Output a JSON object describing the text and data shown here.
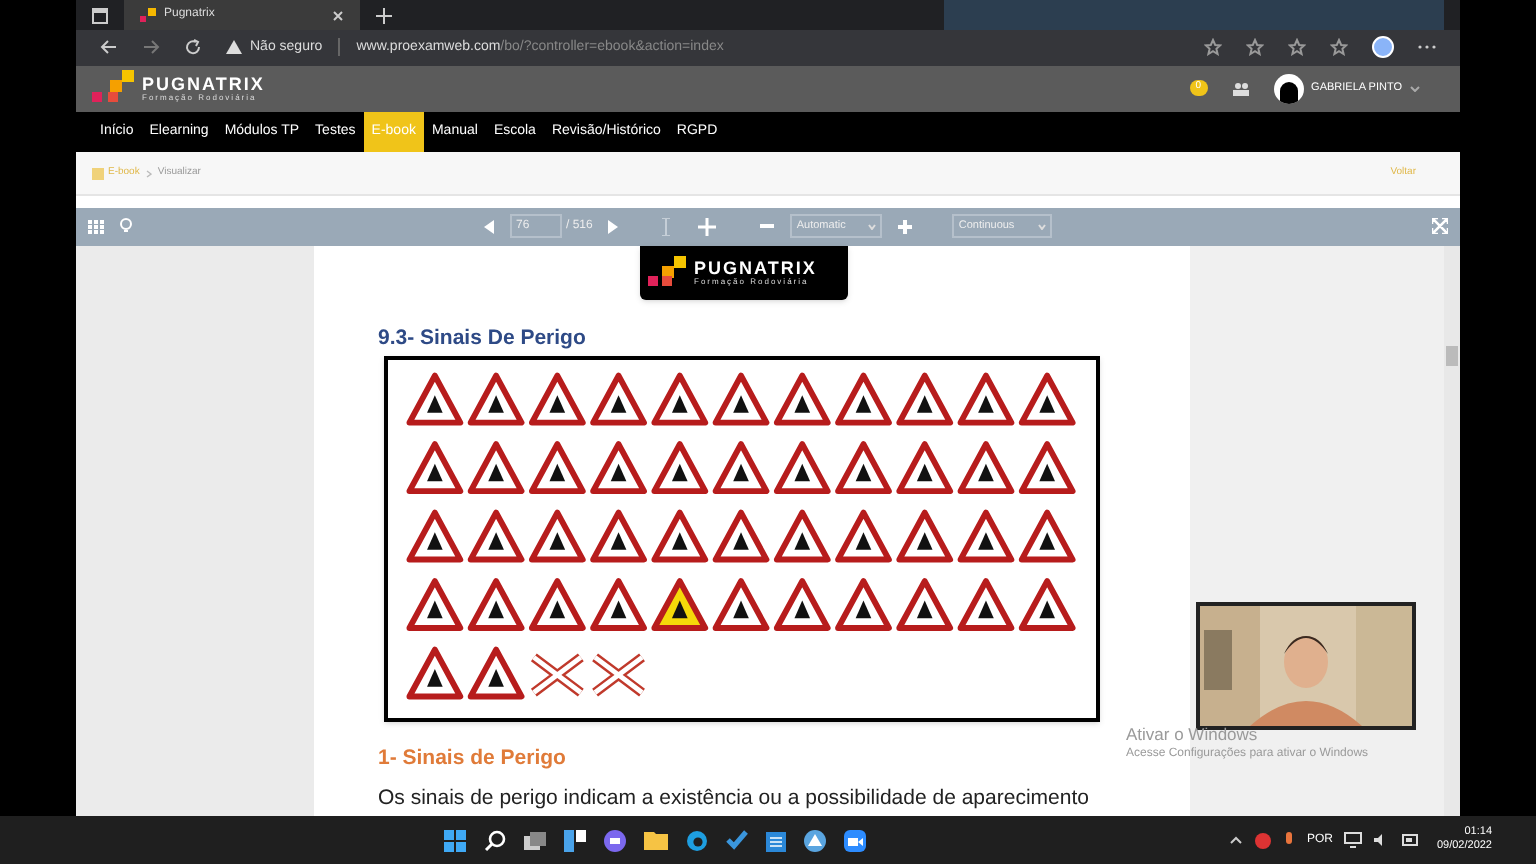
{
  "browser": {
    "tab_title": "Pugnatrix",
    "security": "Não seguro",
    "url_host": "www.proexamweb.com",
    "url_path": "/bo/?controller=ebook&action=index"
  },
  "site": {
    "logo_name": "PUGNATRIX",
    "logo_tagline": "Formação Rodoviária",
    "notification_count": "0",
    "user_name": "GABRIELA PINTO"
  },
  "nav": [
    {
      "label": "Início",
      "selected": false
    },
    {
      "label": "Elearning",
      "selected": false
    },
    {
      "label": "Módulos TP",
      "selected": false
    },
    {
      "label": "Testes",
      "selected": false
    },
    {
      "label": "E-book",
      "selected": true
    },
    {
      "label": "Manual",
      "selected": false
    },
    {
      "label": "Escola",
      "selected": false
    },
    {
      "label": "Revisão/Histórico",
      "selected": false
    },
    {
      "label": "RGPD",
      "selected": false
    }
  ],
  "breadcrumb": [
    "E-book",
    "Visualizar"
  ],
  "back_link": "Voltar",
  "pdf_toolbar": {
    "page": "76",
    "page_total": "/ 516",
    "zoom": "Automatic",
    "scroll_mode": "Continuous"
  },
  "document": {
    "logo_name": "PUGNATRIX",
    "logo_tagline": "Formação Rodoviária",
    "section_title": "9.3- Sinais De Perigo",
    "subheading": "1- Sinais de Perigo",
    "paragraph": "Os sinais de perigo indicam a existência ou a possibilidade de aparecimento"
  },
  "activation": {
    "title": "Ativar o Windows",
    "hint": "Acesse Configurações para ativar o Windows"
  },
  "taskbar": {
    "language": "POR",
    "time": "01:14",
    "date": "09/02/2022"
  }
}
